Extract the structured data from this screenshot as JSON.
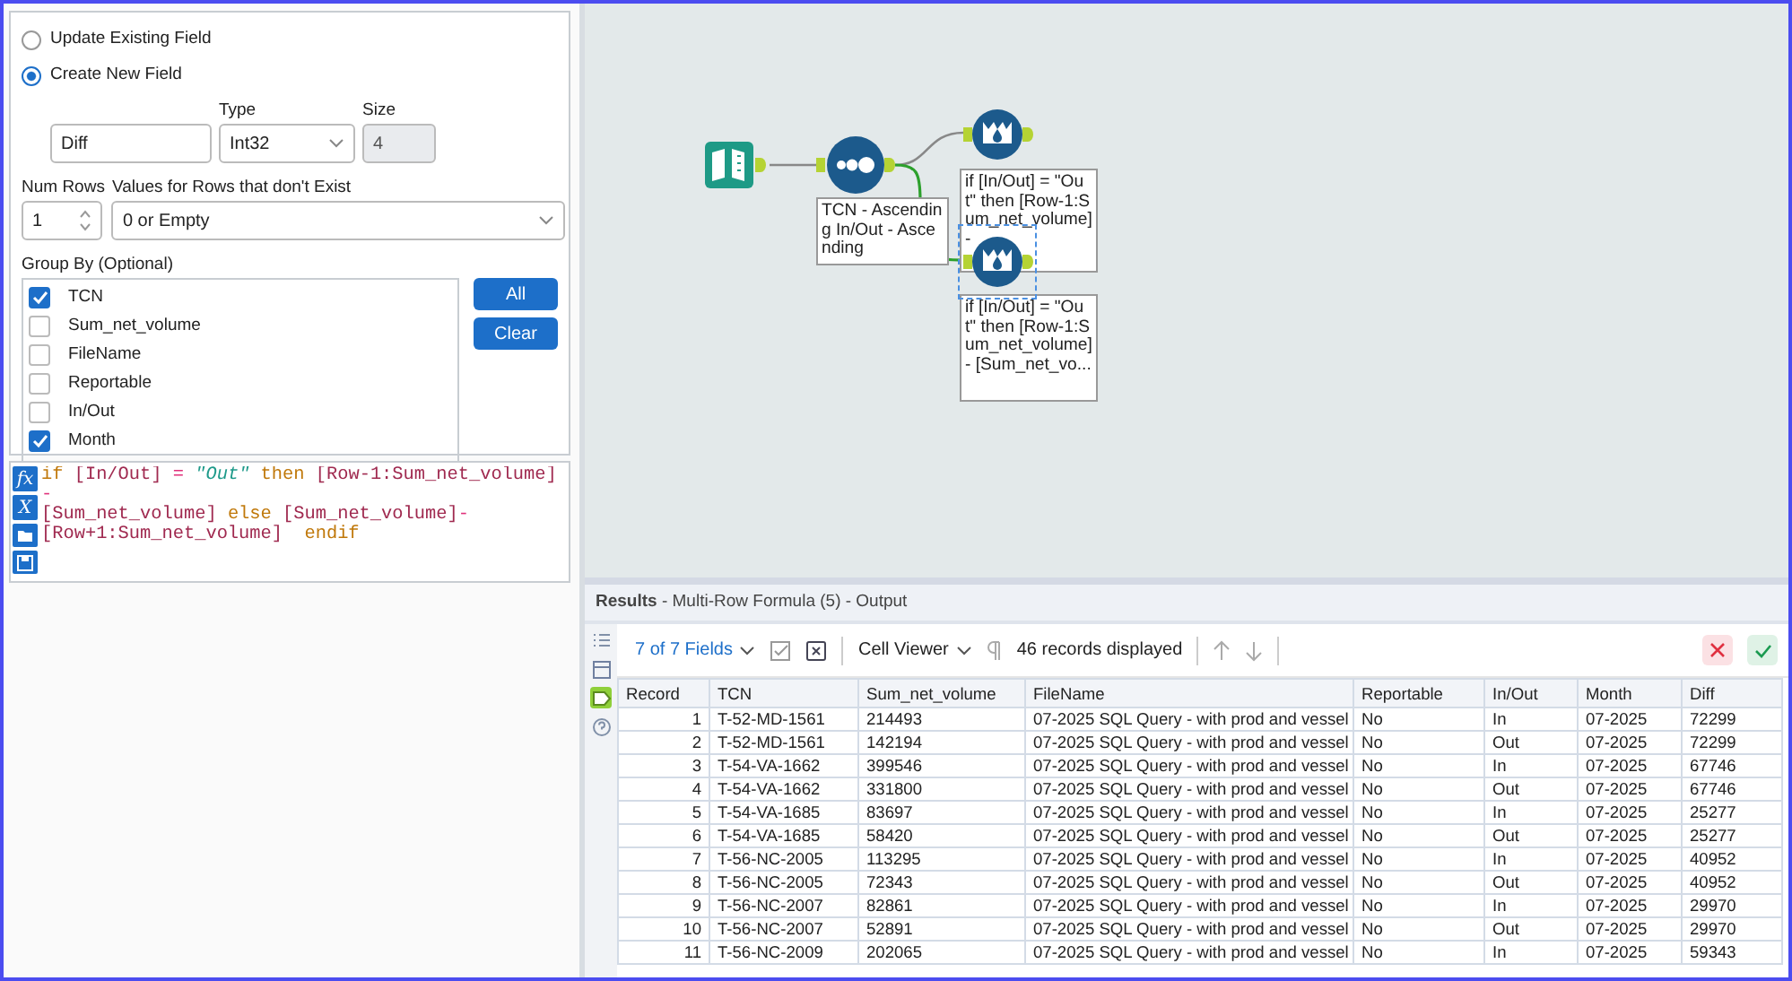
{
  "config": {
    "field_mode": [
      {
        "label": "Update Existing Field",
        "selected": false
      },
      {
        "label": "Create New  Field",
        "selected": true
      }
    ],
    "new_field": {
      "value": "Diff"
    },
    "type": {
      "label": "Type",
      "value": "Int32"
    },
    "size": {
      "label": "Size",
      "value": "4",
      "disabled": true
    },
    "num_rows": {
      "label": "Num Rows",
      "value": "1"
    },
    "missing_rows": {
      "label": "Values for Rows that don't Exist",
      "value": "0 or Empty"
    },
    "group_by": {
      "label": "Group By (Optional)",
      "items": [
        {
          "label": "TCN",
          "checked": true
        },
        {
          "label": "Sum_net_volume",
          "checked": false
        },
        {
          "label": "FileName",
          "checked": false
        },
        {
          "label": "Reportable",
          "checked": false
        },
        {
          "label": "In/Out",
          "checked": false
        },
        {
          "label": "Month",
          "checked": true
        }
      ]
    },
    "buttons": [
      "All",
      "Clear"
    ]
  },
  "formula": {
    "tools": [
      {
        "kind": "function",
        "label": "fx"
      },
      {
        "kind": "variable",
        "label": "X"
      },
      {
        "kind": "open"
      },
      {
        "kind": "save"
      }
    ],
    "tokens": [
      {
        "kind": "keyword",
        "text": "if "
      },
      {
        "kind": "field",
        "text": "[In/Out]"
      },
      {
        "kind": "operator",
        "text": " = "
      },
      {
        "kind": "string",
        "text": "\"Out\""
      },
      {
        "kind": "keyword",
        "text": " then "
      },
      {
        "kind": "field",
        "text": "[Row-1:Sum_net_volume]"
      },
      {
        "kind": "operator",
        "text": " -\n"
      },
      {
        "kind": "field",
        "text": "[Sum_net_volume]"
      },
      {
        "kind": "keyword",
        "text": " else "
      },
      {
        "kind": "field",
        "text": "[Sum_net_volume]"
      },
      {
        "kind": "operator",
        "text": "-\n"
      },
      {
        "kind": "field",
        "text": "[Row+1:Sum_net_volume]"
      },
      {
        "kind": "keyword",
        "text": "  endif"
      }
    ]
  },
  "canvas": {
    "nodes": [
      {
        "kind": "input",
        "selected": false
      },
      {
        "kind": "sort",
        "selected": false
      },
      {
        "kind": "multirow",
        "selected": false
      },
      {
        "kind": "multirow",
        "selected": true
      }
    ],
    "annotations": [
      "TCN - Ascending In/Out - Ascending",
      "if [In/Out] = \"Out\" then [Row-1:Sum_net_volume] -",
      "if [In/Out] = \"Out\" then [Row-1:Sum_net_volume] - [Sum_net_vo..."
    ]
  },
  "results": {
    "title": "**Results** - Multi-Row Formula (5) - Output",
    "view_tabs": [
      {
        "kind": "list",
        "selected": false
      },
      {
        "kind": "table",
        "selected": false
      },
      {
        "kind": "tag",
        "selected": true
      },
      {
        "kind": "help",
        "selected": false
      }
    ],
    "fields": "7 of 7 Fields",
    "viewer": "Cell Viewer",
    "records": "46 records displayed",
    "table": {
      "columns": [
        "Record",
        "TCN",
        "Sum_net_volume",
        "FileName",
        "Reportable",
        "In/Out",
        "Month",
        "Diff"
      ],
      "rows": [
        [
          "1",
          "T-52-MD-1561",
          "214493",
          "07-2025 SQL Query - with prod and vessel",
          "No",
          "In",
          "07-2025",
          "72299"
        ],
        [
          "2",
          "T-52-MD-1561",
          "142194",
          "07-2025 SQL Query - with prod and vessel",
          "No",
          "Out",
          "07-2025",
          "72299"
        ],
        [
          "3",
          "T-54-VA-1662",
          "399546",
          "07-2025 SQL Query - with prod and vessel",
          "No",
          "In",
          "07-2025",
          "67746"
        ],
        [
          "4",
          "T-54-VA-1662",
          "331800",
          "07-2025 SQL Query - with prod and vessel",
          "No",
          "Out",
          "07-2025",
          "67746"
        ],
        [
          "5",
          "T-54-VA-1685",
          "83697",
          "07-2025 SQL Query - with prod and vessel",
          "No",
          "In",
          "07-2025",
          "25277"
        ],
        [
          "6",
          "T-54-VA-1685",
          "58420",
          "07-2025 SQL Query - with prod and vessel",
          "No",
          "Out",
          "07-2025",
          "25277"
        ],
        [
          "7",
          "T-56-NC-2005",
          "113295",
          "07-2025 SQL Query - with prod and vessel",
          "No",
          "In",
          "07-2025",
          "40952"
        ],
        [
          "8",
          "T-56-NC-2005",
          "72343",
          "07-2025 SQL Query - with prod and vessel",
          "No",
          "Out",
          "07-2025",
          "40952"
        ],
        [
          "9",
          "T-56-NC-2007",
          "82861",
          "07-2025 SQL Query - with prod and vessel",
          "No",
          "In",
          "07-2025",
          "29970"
        ],
        [
          "10",
          "T-56-NC-2007",
          "52891",
          "07-2025 SQL Query - with prod and vessel",
          "No",
          "Out",
          "07-2025",
          "29970"
        ],
        [
          "11",
          "T-56-NC-2009",
          "202065",
          "07-2025 SQL Query - with prod and vessel",
          "No",
          "In",
          "07-2025",
          "59343"
        ]
      ]
    }
  }
}
